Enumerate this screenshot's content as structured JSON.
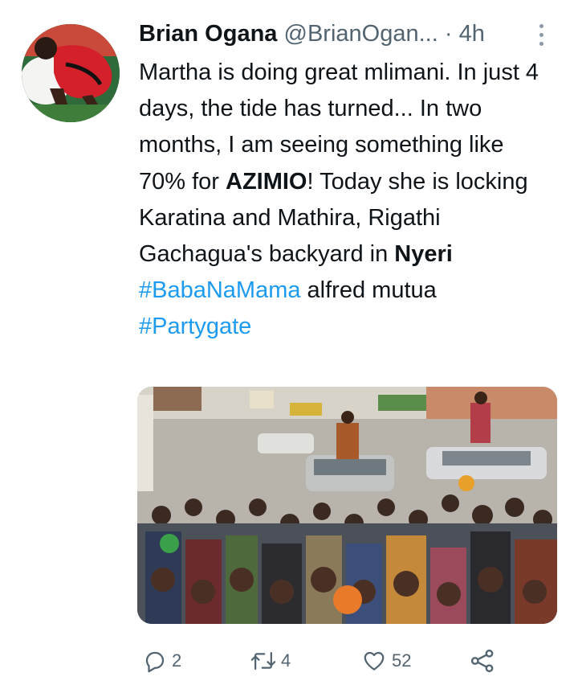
{
  "tweet": {
    "author_name": "Brian Ogana",
    "handle": "@BrianOgan...",
    "separator": "·",
    "time": "4h",
    "text": {
      "p1": "Martha is doing great mlimani. In just 4 days, the tide has turned... In two months, I am seeing something like 70% for ",
      "p1_bold": "AZIMIO",
      "p1_end": "! Today she is locking Karatina and Mathira, Rigathi Gachagua's backyard in ",
      "p1_bold2": "Nyeri",
      "hashtag1": "#BabaNaMama",
      "after_hashtag1": " alfred mutua",
      "hashtag2": "#Partygate"
    },
    "media_alt": "photo of a crowd surrounding vehicles at a political rally"
  },
  "actions": {
    "reply_count": "2",
    "retweet_count": "4",
    "like_count": "52"
  },
  "icons": {
    "more": "more-vertical-icon",
    "reply": "reply-icon",
    "retweet": "retweet-icon",
    "like": "heart-icon",
    "share": "share-icon"
  },
  "colors": {
    "hashtag": "#1d9bf0",
    "secondary_text": "#536471",
    "primary_text": "#0f1419"
  }
}
